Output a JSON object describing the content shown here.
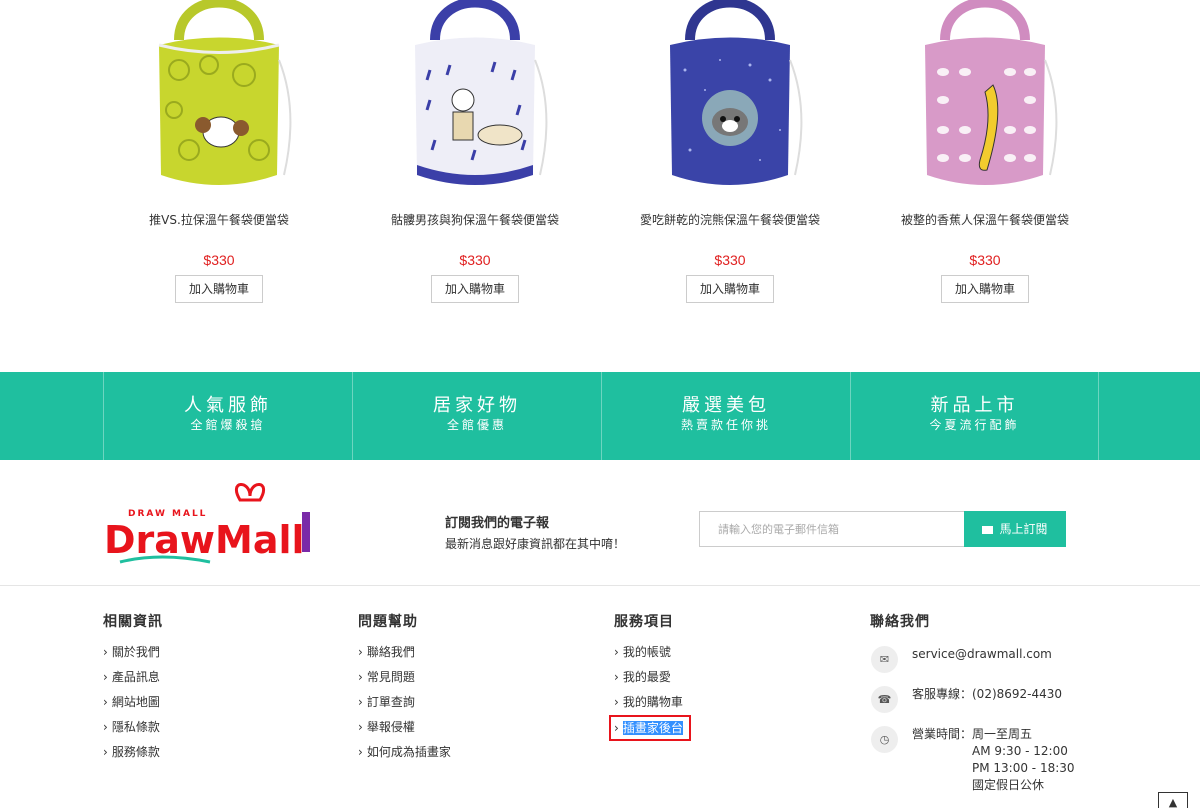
{
  "products": [
    {
      "name": "推VS.拉保溫午餐袋便當袋",
      "price": "$330",
      "cart_label": "加入購物車",
      "bag_color": "#c8d62e",
      "strap_color": "#b8c82a"
    },
    {
      "name": "骷髏男孩與狗保溫午餐袋便當袋",
      "price": "$330",
      "cart_label": "加入購物車",
      "bag_color": "#e8e8f4",
      "strap_color": "#3b3fa8"
    },
    {
      "name": "愛吃餅乾的浣熊保溫午餐袋便當袋",
      "price": "$330",
      "cart_label": "加入購物車",
      "bag_color": "#3a44a8",
      "strap_color": "#2f3690"
    },
    {
      "name": "被整的香蕉人保溫午餐袋便當袋",
      "price": "$330",
      "cart_label": "加入購物車",
      "bag_color": "#d89ac8",
      "strap_color": "#d08cc0"
    }
  ],
  "categories": [
    {
      "title": "人氣服飾",
      "sub": "全館爆殺搶"
    },
    {
      "title": "居家好物",
      "sub": "全館優惠"
    },
    {
      "title": "嚴選美包",
      "sub": "熱賣款任你挑"
    },
    {
      "title": "新品上市",
      "sub": "今夏流行配飾"
    }
  ],
  "brand": {
    "top_text": "DRAW MALL",
    "logo_text": "DrawMall"
  },
  "newsletter": {
    "title": "訂閱我們的電子報",
    "subtitle": "最新消息跟好康資訊都在其中唷！",
    "placeholder": "請輸入您的電子郵件信箱",
    "button": "馬上訂閱"
  },
  "footer": {
    "col1": {
      "title": "相關資訊",
      "items": [
        "關於我們",
        "產品訊息",
        "網站地圖",
        "隱私條款",
        "服務條款"
      ]
    },
    "col2": {
      "title": "問題幫助",
      "items": [
        "聯絡我們",
        "常見問題",
        "訂單查詢",
        "舉報侵權",
        "如何成為插畫家"
      ]
    },
    "col3": {
      "title": "服務項目",
      "items": [
        "我的帳號",
        "我的最愛",
        "我的購物車",
        "插畫家後台"
      ]
    },
    "contact": {
      "title": "聯絡我們",
      "email": "service@drawmall.com",
      "phone": "客服專線：(02)8692-4430",
      "hours_label": "營業時間：周一至周五",
      "hours_1": "AM 9:30 - 12:00",
      "hours_2": "PM 13:00 - 18:30",
      "hours_3": "國定假日公休"
    }
  },
  "icons": {
    "arrow": "›",
    "email": "envelope-icon",
    "phone": "phone-icon",
    "clock": "clock-icon",
    "top": "chevron-up-icon"
  },
  "colors": {
    "accent": "#1fbf9f",
    "price": "#e02020",
    "highlight": "#e8141c"
  }
}
